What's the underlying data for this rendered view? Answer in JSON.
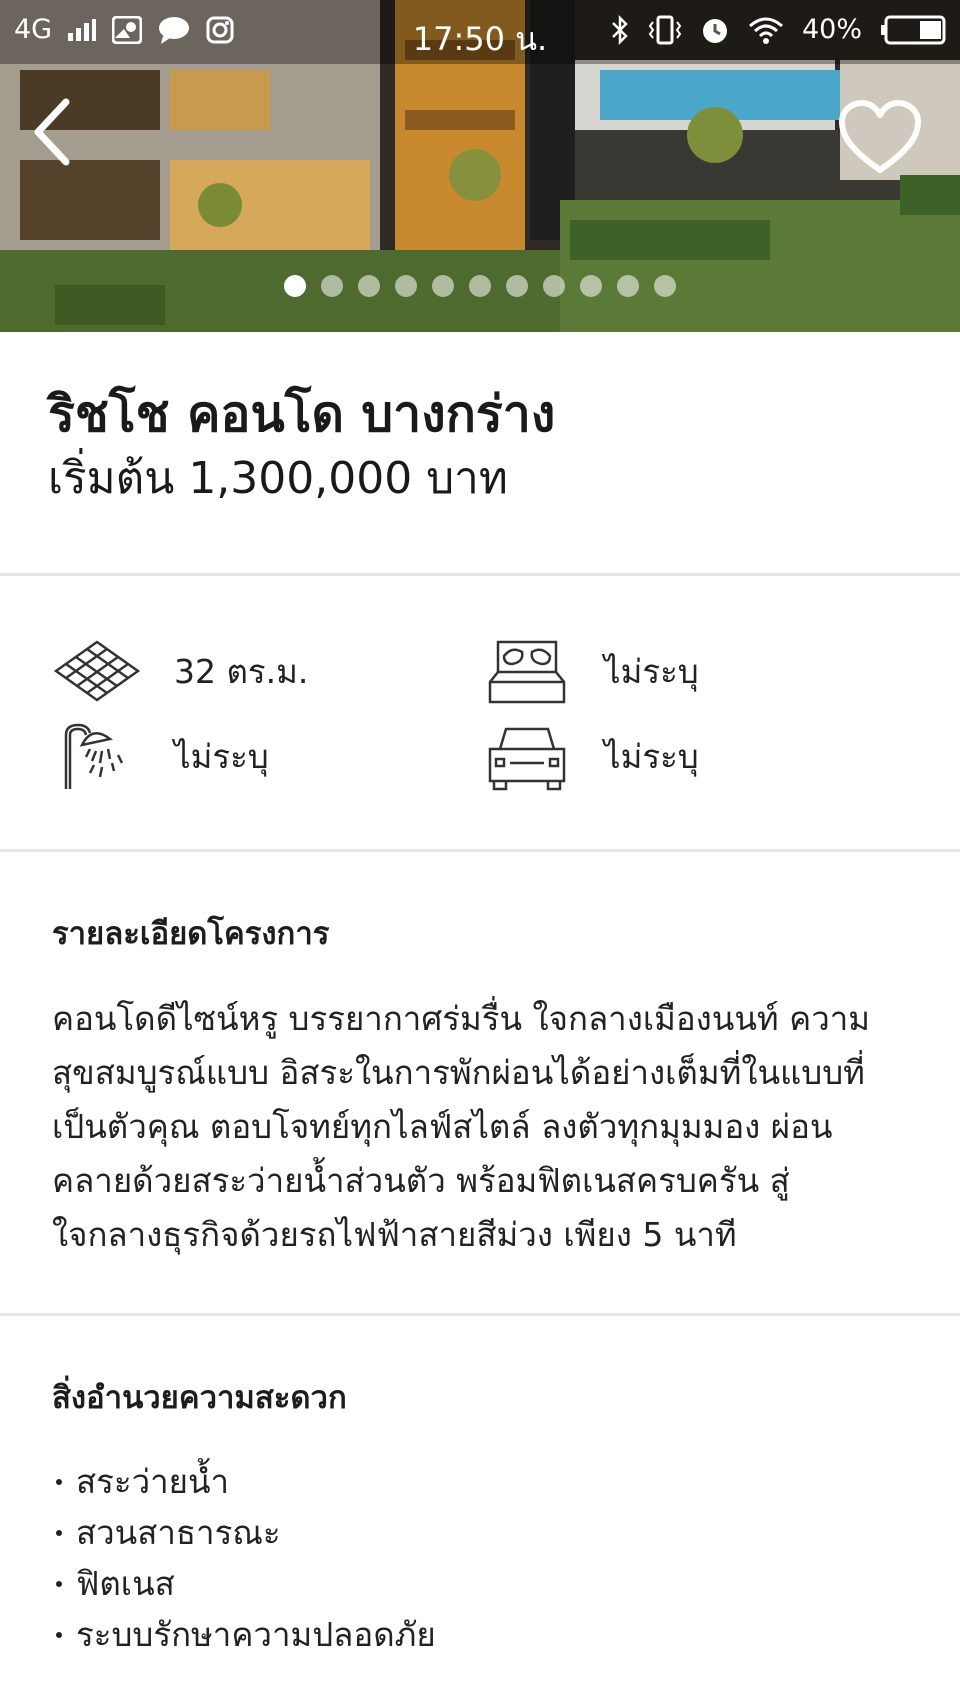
{
  "status_bar": {
    "network": "4G",
    "time": "17:50 น.",
    "battery": "40%",
    "battery_level": 0.4
  },
  "gallery": {
    "total_images": 11,
    "active_index": 0
  },
  "project": {
    "title": "ริชโช คอนโด บางกร่าง",
    "price": "เริ่มต้น 1,300,000 บาท"
  },
  "specs": {
    "area": "32 ตร.ม.",
    "bedrooms": "ไม่ระบุ",
    "bathrooms": "ไม่ระบุ",
    "parking": "ไม่ระบุ"
  },
  "details": {
    "heading": "รายละเอียดโครงการ",
    "lines": [
      "คอนโดดีไซน์หรู บรรยากาศร่มรื่น ใจกลางเมืองนนท์ ความ",
      "สุขสมบูรณ์แบบ อิสระในการพักผ่อนได้อย่างเต็มที่ในแบบที่",
      "เป็นตัวคุณ ตอบโจทย์ทุกไลฟ์สไตล์ ลงตัวทุกมุมมอง ผ่อน",
      "คลายด้วยสระว่ายน้ำส่วนตัว พร้อมฟิตเนสครบครัน สู่",
      "ใจกลางธุรกิจด้วยรถไฟฟ้าสายสีม่วง เพียง 5 นาที"
    ]
  },
  "amenities": {
    "heading": "สิ่งอำนวยความสะดวก",
    "items": [
      "สระว่ายน้ำ",
      "สวนสาธารณะ",
      "ฟิตเนส",
      "ระบบรักษาความปลอดภัย"
    ]
  }
}
